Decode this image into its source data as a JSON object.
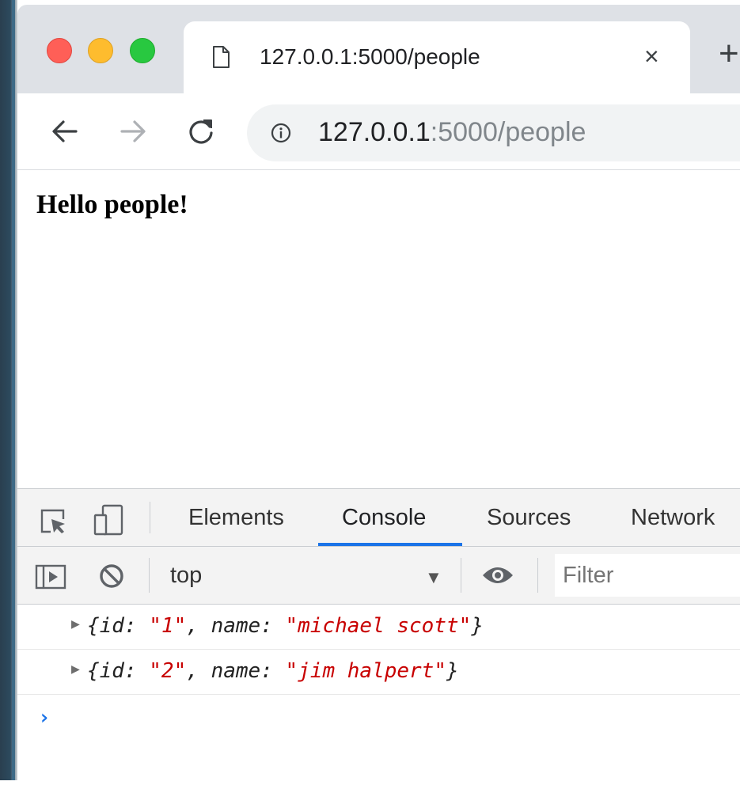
{
  "browser": {
    "tab": {
      "title": "127.0.0.1:5000/people",
      "close_glyph": "×"
    },
    "new_tab_glyph": "+",
    "address": {
      "host": "127.0.0.1",
      "rest": ":5000/people"
    }
  },
  "page": {
    "heading": "Hello people!"
  },
  "devtools": {
    "tabs": [
      "Elements",
      "Console",
      "Sources",
      "Network"
    ],
    "active_tab": "Console",
    "context": "top",
    "filter_placeholder": "Filter",
    "console": {
      "rows": [
        {
          "id_key": "id:",
          "id_value": "\"1\"",
          "name_key": "name:",
          "name_value": "\"michael scott\""
        },
        {
          "id_key": "id:",
          "id_value": "\"2\"",
          "name_key": "name:",
          "name_value": "\"jim halpert\""
        }
      ],
      "prompt": "›"
    }
  },
  "colors": {
    "accent": "#1a73e8",
    "console_string": "#c80000",
    "traffic_red": "#ff5f57",
    "traffic_yellow": "#febc2e",
    "traffic_green": "#28c840"
  },
  "icons": [
    "document-icon",
    "close-icon",
    "plus-icon",
    "back-arrow-icon",
    "forward-arrow-icon",
    "reload-icon",
    "info-icon",
    "inspect-element-icon",
    "device-toolbar-icon",
    "sidebar-toggle-icon",
    "clear-console-icon",
    "dropdown-caret-icon",
    "eye-icon"
  ]
}
